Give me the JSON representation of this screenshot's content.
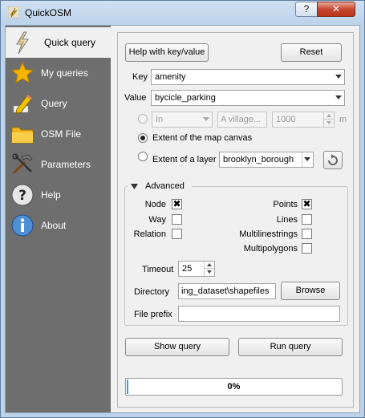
{
  "window": {
    "title": "QuickOSM",
    "help_button": "?",
    "close_button": "✕"
  },
  "sidebar": {
    "items": [
      {
        "label": "Quick query",
        "icon": "lightning-icon",
        "active": true
      },
      {
        "label": "My queries",
        "icon": "star-icon",
        "active": false
      },
      {
        "label": "Query",
        "icon": "pencil-icon",
        "active": false
      },
      {
        "label": "OSM File",
        "icon": "folder-icon",
        "active": false
      },
      {
        "label": "Parameters",
        "icon": "tools-icon",
        "active": false
      },
      {
        "label": "Help",
        "icon": "help-icon",
        "active": false
      },
      {
        "label": "About",
        "icon": "info-icon",
        "active": false
      }
    ]
  },
  "main": {
    "help_keyvalue_button": "Help with key/value",
    "reset_button": "Reset",
    "key_label": "Key",
    "key_value": "amenity",
    "value_label": "Value",
    "value_value": "bycicle_parking",
    "in_combo": "In",
    "village_placeholder": "A village...",
    "distance_value": "1000",
    "distance_unit": "m",
    "extent_canvas_label": "Extent of the map canvas",
    "extent_layer_label": "Extent of a layer",
    "layer_combo": "brooklyn_borough",
    "advanced_label": "Advanced",
    "node_label": "Node",
    "way_label": "Way",
    "relation_label": "Relation",
    "points_label": "Points",
    "lines_label": "Lines",
    "multilinestrings_label": "Multilinestrings",
    "multipolygons_label": "Multipolygons",
    "node_checked": true,
    "points_checked": true,
    "check_mark": "✖",
    "timeout_label": "Timeout",
    "timeout_value": "25",
    "directory_label": "Directory",
    "directory_value": "ing_dataset\\shapefiles",
    "browse_button": "Browse",
    "file_prefix_label": "File prefix",
    "file_prefix_value": "",
    "show_query_button": "Show query",
    "run_query_button": "Run query",
    "progress_text": "0%",
    "progress_value": 0
  }
}
